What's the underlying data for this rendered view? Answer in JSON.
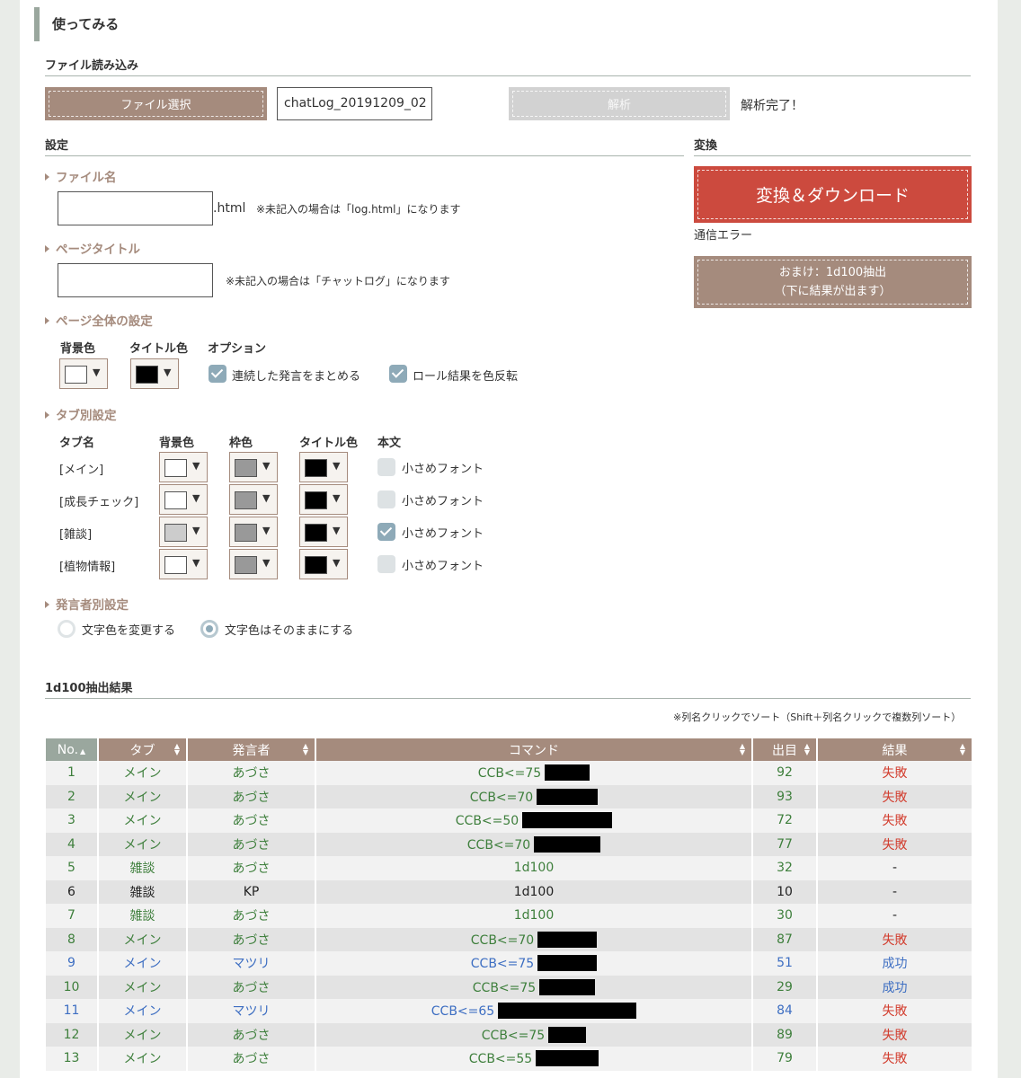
{
  "section_heading": "使ってみる",
  "file_load": {
    "title": "ファイル読み込み",
    "select_button": "ファイル選択",
    "file_value": "chatLog_20191209_02",
    "analyze_button": "解析",
    "status": "解析完了！"
  },
  "settings": {
    "title": "設定",
    "filename": {
      "label": "ファイル名",
      "value": "",
      "suffix": ".html",
      "note": "※未記入の場合は「log.html」になります"
    },
    "page_title": {
      "label": "ページタイトル",
      "value": "",
      "note": "※未記入の場合は「チャットログ」になります"
    },
    "page_all": {
      "label": "ページ全体の設定",
      "bg_color_label": "背景色",
      "title_color_label": "タイトル色",
      "options_label": "オプション",
      "bg_color": "#ffffff",
      "title_color": "#000000",
      "options": [
        {
          "label": "連続した発言をまとめる",
          "checked": true
        },
        {
          "label": "ロール結果を色反転",
          "checked": true
        }
      ]
    },
    "tab_settings": {
      "label": "タブ別設定",
      "headers": [
        "タブ名",
        "背景色",
        "枠色",
        "タイトル色",
        "本文"
      ],
      "small_font_label": "小さめフォント",
      "tabs": [
        {
          "name": "[メイン]",
          "bg": "#ffffff",
          "border": "#999999",
          "title": "#000000",
          "small_font": false
        },
        {
          "name": "[成長チェック]",
          "bg": "#ffffff",
          "border": "#999999",
          "title": "#000000",
          "small_font": false
        },
        {
          "name": "[雑談]",
          "bg": "#cccccc",
          "border": "#999999",
          "title": "#000000",
          "small_font": true
        },
        {
          "name": "[植物情報]",
          "bg": "#ffffff",
          "border": "#999999",
          "title": "#000000",
          "small_font": false
        }
      ]
    },
    "speaker_settings": {
      "label": "発言者別設定",
      "options": [
        {
          "label": "文字色を変更する",
          "selected": false
        },
        {
          "label": "文字色はそのままにする",
          "selected": true
        }
      ]
    }
  },
  "convert": {
    "title": "変換",
    "download_button": "変換＆ダウンロード",
    "status": "通信エラー",
    "bonus_button_line1": "おまけ：1d100抽出",
    "bonus_button_line2": "（下に結果が出ます）"
  },
  "results": {
    "title": "1d100抽出結果",
    "sort_note": "※列名クリックでソート（Shift＋列名クリックで複数列ソート）",
    "headers": [
      "No.",
      "タブ",
      "発言者",
      "コマンド",
      "出目",
      "結果"
    ],
    "rows": [
      {
        "no": "1",
        "tab": "メイン",
        "speaker": "あづさ",
        "command": "CCB<=75",
        "roll": "92",
        "result": "失敗",
        "color": "green"
      },
      {
        "no": "2",
        "tab": "メイン",
        "speaker": "あづさ",
        "command": "CCB<=70",
        "roll": "93",
        "result": "失敗",
        "color": "green"
      },
      {
        "no": "3",
        "tab": "メイン",
        "speaker": "あづさ",
        "command": "CCB<=50",
        "roll": "72",
        "result": "失敗",
        "color": "green"
      },
      {
        "no": "4",
        "tab": "メイン",
        "speaker": "あづさ",
        "command": "CCB<=70",
        "roll": "77",
        "result": "失敗",
        "color": "green"
      },
      {
        "no": "5",
        "tab": "雑談",
        "speaker": "あづさ",
        "command": "1d100",
        "roll": "32",
        "result": "-",
        "color": "green"
      },
      {
        "no": "6",
        "tab": "雑談",
        "speaker": "KP",
        "command": "1d100",
        "roll": "10",
        "result": "-",
        "color": "black"
      },
      {
        "no": "7",
        "tab": "雑談",
        "speaker": "あづさ",
        "command": "1d100",
        "roll": "30",
        "result": "-",
        "color": "green"
      },
      {
        "no": "8",
        "tab": "メイン",
        "speaker": "あづさ",
        "command": "CCB<=70",
        "roll": "87",
        "result": "失敗",
        "color": "green"
      },
      {
        "no": "9",
        "tab": "メイン",
        "speaker": "マツリ",
        "command": "CCB<=75",
        "roll": "51",
        "result": "成功",
        "color": "blue"
      },
      {
        "no": "10",
        "tab": "メイン",
        "speaker": "あづさ",
        "command": "CCB<=75",
        "roll": "29",
        "result": "成功",
        "color": "green"
      },
      {
        "no": "11",
        "tab": "メイン",
        "speaker": "マツリ",
        "command": "CCB<=65",
        "roll": "84",
        "result": "失敗",
        "color": "blue"
      },
      {
        "no": "12",
        "tab": "メイン",
        "speaker": "あづさ",
        "command": "CCB<=75",
        "roll": "89",
        "result": "失敗",
        "color": "green"
      },
      {
        "no": "13",
        "tab": "メイン",
        "speaker": "あづさ",
        "command": "CCB<=55",
        "roll": "79",
        "result": "失敗",
        "color": "green"
      }
    ]
  }
}
